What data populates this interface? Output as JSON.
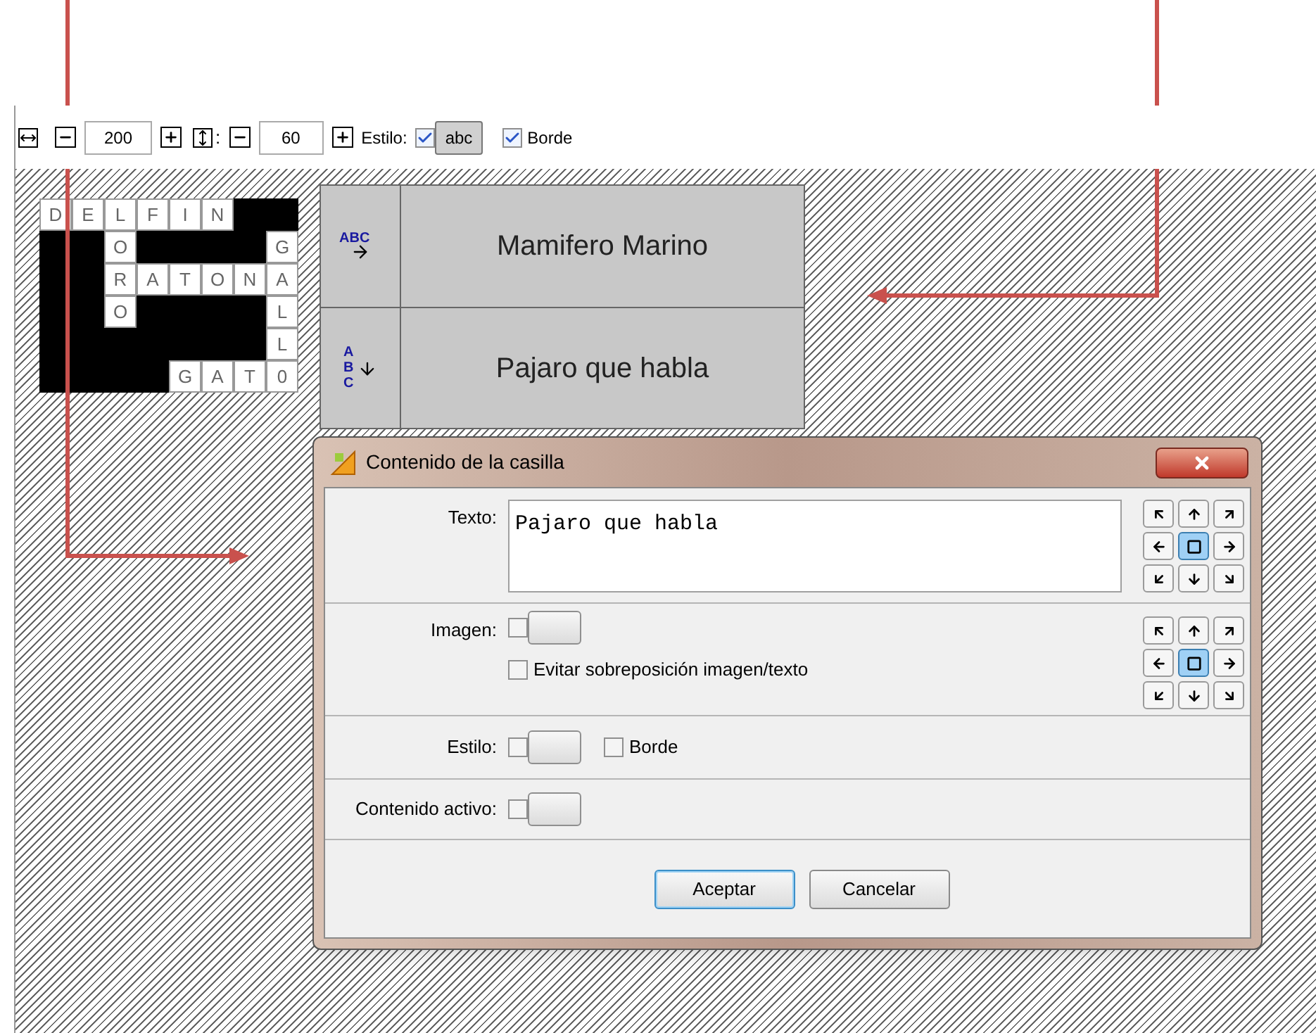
{
  "toolbar": {
    "width_value": "200",
    "height_suffix": ":",
    "height_value": "60",
    "style_label": "Estilo:",
    "style_checked": true,
    "style_button": "abc",
    "style_pressed": true,
    "border_checked": true,
    "border_label": "Borde"
  },
  "crossword": {
    "rows": [
      [
        "D",
        "E",
        "L",
        "F",
        "I",
        "N",
        null,
        null
      ],
      [
        null,
        null,
        "O",
        null,
        null,
        null,
        null,
        "G"
      ],
      [
        null,
        null,
        "R",
        "A",
        "T",
        "O",
        "N",
        "A"
      ],
      [
        null,
        null,
        "O",
        null,
        null,
        null,
        null,
        "L"
      ],
      [
        null,
        null,
        null,
        null,
        null,
        null,
        null,
        "L"
      ],
      [
        null,
        null,
        null,
        null,
        "G",
        "A",
        "T",
        "0"
      ]
    ]
  },
  "clues": [
    {
      "kind": "across",
      "icon_text": "ABC",
      "text": "Mamifero Marino"
    },
    {
      "kind": "down",
      "icon_text": "ABC",
      "text": "Pajaro que habla"
    }
  ],
  "dialog": {
    "title": "Contenido de la casilla",
    "text_label": "Texto:",
    "text_value": "Pajaro que habla",
    "text_alignment": [
      {
        "selected": false
      },
      {
        "selected": false
      },
      {
        "selected": false
      },
      {
        "selected": false
      },
      {
        "selected": true
      },
      {
        "selected": false
      },
      {
        "selected": false
      },
      {
        "selected": false
      },
      {
        "selected": false
      }
    ],
    "image_label": "Imagen:",
    "image_checked": false,
    "avoid_overlap": {
      "label": "Evitar sobreposición imagen/texto",
      "checked": false
    },
    "image_alignment": [
      {
        "selected": false
      },
      {
        "selected": false
      },
      {
        "selected": false
      },
      {
        "selected": false
      },
      {
        "selected": true
      },
      {
        "selected": false
      },
      {
        "selected": false
      },
      {
        "selected": false
      },
      {
        "selected": false
      }
    ],
    "style_label": "Estilo:",
    "style_checked": false,
    "border": {
      "label": "Borde",
      "checked": false
    },
    "active_label": "Contenido activo:",
    "active_checked": false,
    "buttons": [
      {
        "label": "Aceptar",
        "default": true
      },
      {
        "label": "Cancelar",
        "default": false
      }
    ]
  }
}
